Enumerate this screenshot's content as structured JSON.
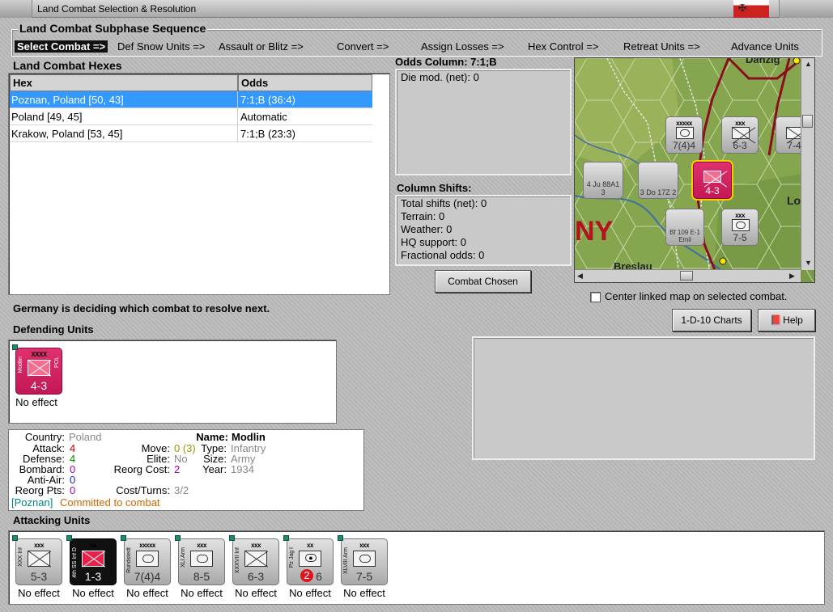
{
  "window": {
    "title": "Land Combat Selection & Resolution"
  },
  "subphase": {
    "heading": "Land Combat Subphase Sequence",
    "steps": [
      "Select Combat =>",
      "Def Snow Units =>",
      "Assault or Blitz =>",
      "Convert =>",
      "Assign Losses =>",
      "Hex Control =>",
      "Retreat Units =>",
      "Advance Units"
    ]
  },
  "hexes": {
    "heading": "Land Combat Hexes",
    "columns": [
      "Hex",
      "Odds"
    ],
    "rows": [
      {
        "hex": "Poznan, Poland [50, 43]",
        "odds": "7:1;B (36:4)"
      },
      {
        "hex": "Poland [49, 45]",
        "odds": "Automatic"
      },
      {
        "hex": "Krakow, Poland [53, 45]",
        "odds": "7:1;B (23:3)"
      }
    ]
  },
  "odds": {
    "heading": "Odds Column: 7:1;B",
    "die_mod": "Die mod. (net): 0"
  },
  "shifts": {
    "heading": "Column Shifts:",
    "lines": [
      "Total shifts (net): 0",
      "Terrain: 0",
      "Weather: 0",
      "HQ support: 0",
      "Fractional odds: 0"
    ]
  },
  "buttons": {
    "combat_chosen": "Combat Chosen",
    "charts": "1-D-10 Charts",
    "help": "Help"
  },
  "map": {
    "checkbox_label": "Center linked map on selected combat.",
    "labels": {
      "danzig": "Danzig",
      "breslau": "Breslau",
      "lo": "Lo",
      "ny": "NY"
    },
    "counters": [
      {
        "size": "xxxxx",
        "str": "7(4)4",
        "num": "2"
      },
      {
        "size": "xxx",
        "str": "6-3",
        "num": ""
      },
      {
        "size": "",
        "str": "7-4",
        "num": ""
      },
      {
        "size": "",
        "str": "3 Do 17Z 2",
        "num": "3"
      },
      {
        "size": "",
        "str": "4 Ju 88A1 3",
        "num": ""
      },
      {
        "size": "",
        "str": "4-3",
        "num": ""
      },
      {
        "size": "",
        "str": "Bf 109 E-1 Emil",
        "num": "4"
      },
      {
        "size": "xxx",
        "str": "7-5",
        "num": "2"
      }
    ]
  },
  "status_text": "Germany is deciding which combat to resolve next.",
  "defending": {
    "heading": "Defending Units",
    "units": [
      {
        "size": "XXXX",
        "side": "Modlin",
        "side2": "POL",
        "str": "4-3",
        "effect": "No effect"
      }
    ]
  },
  "info": {
    "country_k": "Country:",
    "country_v": "Poland",
    "attack_k": "Attack:",
    "attack_v": "4",
    "defense_k": "Defense:",
    "defense_v": "4",
    "bombard_k": "Bombard:",
    "bombard_v": "0",
    "antiair_k": "Anti-Air:",
    "antiair_v": "0",
    "reorgpts_k": "Reorg Pts:",
    "reorgpts_v": "0",
    "name_k": "Name:",
    "name_v": "Modlin",
    "move_k": "Move:",
    "move_v": "0 (3)",
    "elite_k": "Elite:",
    "elite_v": "No",
    "reorgcost_k": "Reorg Cost:",
    "reorgcost_v": "2",
    "type_k": "Type:",
    "type_v": "Infantry",
    "size_k": "Size:",
    "size_v": "Army",
    "year_k": "Year:",
    "year_v": "1934",
    "costturns_k": "Cost/Turns:",
    "costturns_v": "3/2",
    "location": "[Poznan]",
    "committed": "Committed to combat"
  },
  "attacking": {
    "heading": "Attacking Units",
    "units": [
      {
        "size": "xxx",
        "side": "XXX Inf",
        "str": "5-3",
        "effect": "No effect",
        "style": "gray",
        "sym": "inf"
      },
      {
        "size": "xx",
        "side": "4th SS Inf D",
        "str": "1-3",
        "effect": "No effect",
        "style": "black",
        "sym": "inf"
      },
      {
        "size": "xxxxx",
        "side": "Rundstedt",
        "str": "7(4)4",
        "effect": "No effect",
        "style": "gray",
        "sym": "arm"
      },
      {
        "size": "xxx",
        "side": "XLI Arm",
        "str": "8-5",
        "effect": "No effect",
        "style": "gray",
        "sym": "arm"
      },
      {
        "size": "xxx",
        "side": "XXXVII Inf",
        "str": "6-3",
        "effect": "No effect",
        "style": "gray",
        "sym": "inf"
      },
      {
        "size": "xx",
        "side": "Pz Jag I",
        "str": "6",
        "strbadge": "2",
        "effect": "No effect",
        "style": "gray",
        "sym": "at"
      },
      {
        "size": "xxx",
        "side": "XLVIII Arm",
        "str": "7-5",
        "effect": "No effect",
        "style": "gray",
        "sym": "arm"
      }
    ]
  },
  "colors": {
    "selection": "#3399ff",
    "attack": "#cc0000",
    "defense": "#008800",
    "bombard": "#aa00aa",
    "antiair": "#2222cc",
    "committed": "#cc6600",
    "location": "#008888",
    "defender_counter": "#c21857"
  }
}
